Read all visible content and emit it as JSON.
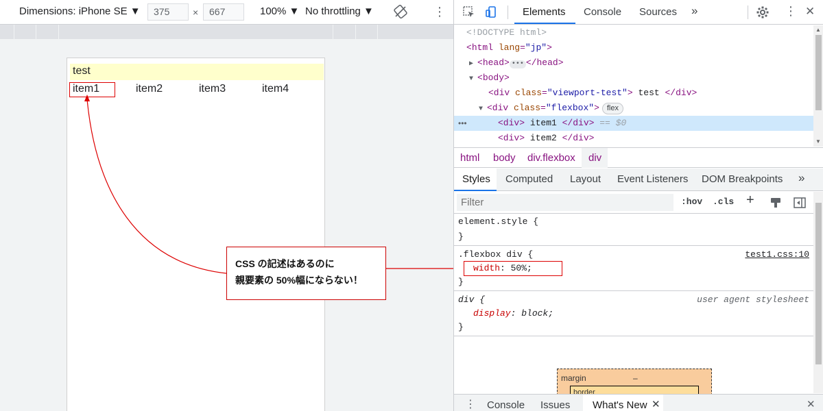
{
  "emulation": {
    "dimensions_label": "Dimensions: iPhone SE ▼",
    "width_value": "375",
    "times": "×",
    "height_value": "667",
    "zoom_label": "100% ▼",
    "throttle_label": "No throttling ▼",
    "kebab": "⋮"
  },
  "page": {
    "viewport_text": "test",
    "items": [
      "item1",
      "item2",
      "item3",
      "item4"
    ],
    "annotation": {
      "line1": "CSS の記述はあるのに",
      "line2": "親要素の 50%幅にならない！"
    }
  },
  "devtools": {
    "tabs": [
      "Elements",
      "Console",
      "Sources"
    ],
    "more": "»",
    "kebab": "⋮",
    "close": "✕",
    "tree": {
      "doctype": "<!DOCTYPE html>",
      "html_tag": "html",
      "html_attr": "lang",
      "html_val": "\"jp\"",
      "head_tag": "head",
      "body_tag": "body",
      "div1_class": "\"viewport-test\"",
      "div1_text": " test ",
      "div2_class": "\"flexbox\"",
      "flex_badge": "flex",
      "item1_text": " item1 ",
      "selected_marker": "== $0",
      "item2_text": " item2 ",
      "gutter_dots": "•••"
    },
    "breadcrumbs": [
      "html",
      "body",
      "div.flexbox",
      "div"
    ],
    "sub_tabs": [
      "Styles",
      "Computed",
      "Layout",
      "Event Listeners",
      "DOM Breakpoints"
    ],
    "filter_placeholder": "Filter",
    "hov": ":hov",
    "cls": ".cls",
    "plus": "+",
    "rules": {
      "element_style": "element.style {",
      "close_brace": "}",
      "flex_selector": ".flexbox div {",
      "flex_source": "test1.css:10",
      "flex_prop": "width",
      "flex_val": "50%;",
      "ua_selector": "div {",
      "ua_source": "user agent stylesheet",
      "ua_prop": "display",
      "ua_val": "block;"
    },
    "box_model": {
      "margin_label": "margin",
      "margin_value": "–",
      "border_label": "border"
    },
    "drawer": {
      "tabs": [
        "Console",
        "Issues",
        "What's New"
      ]
    }
  }
}
